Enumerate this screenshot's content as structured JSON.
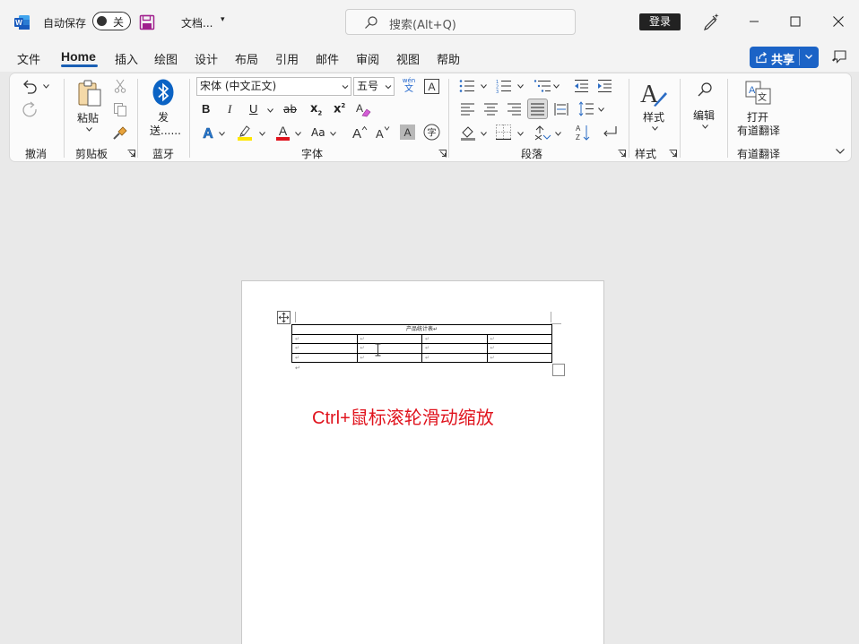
{
  "titlebar": {
    "autosave_label": "自动保存",
    "autosave_state": "关",
    "doc_name": "文档...",
    "search_placeholder": "搜索(Alt+Q)",
    "login_label": "登录"
  },
  "menu": {
    "items": [
      "文件",
      "Home",
      "插入",
      "绘图",
      "设计",
      "布局",
      "引用",
      "邮件",
      "审阅",
      "视图",
      "帮助"
    ],
    "active": "Home",
    "share_label": "共享"
  },
  "ribbon": {
    "groups": {
      "undo": "撤消",
      "clipboard": "剪贴板",
      "bluetooth": "蓝牙",
      "font": "字体",
      "paragraph": "段落",
      "styles": "样式",
      "youdao": "有道翻译"
    },
    "paste_label": "粘贴",
    "bluetooth_send_line1": "发",
    "bluetooth_send_line2": "送......",
    "font_name": "宋体 (中文正文)",
    "font_size": "五号",
    "phonetic_top": "wén",
    "phonetic_bottom": "文",
    "bold": "B",
    "italic": "I",
    "underline": "U",
    "strike": "ab",
    "subscript": "x",
    "subscript_sub": "2",
    "superscript": "x",
    "superscript_sup": "2",
    "change_case": "Aa",
    "styles_label": "样式",
    "edit_label": "编辑",
    "youdao_line1": "打开",
    "youdao_line2": "有道翻译"
  },
  "document": {
    "table_title": "产品统计表",
    "cell_mark": "↵",
    "rows": 3,
    "cols": 4,
    "hint_text": "Ctrl+鼠标滚轮滑动缩放"
  },
  "colors": {
    "accent": "#1b63c6",
    "hint": "#e0141e",
    "highlight": "#ffe600",
    "font_color": "#e0141e"
  }
}
